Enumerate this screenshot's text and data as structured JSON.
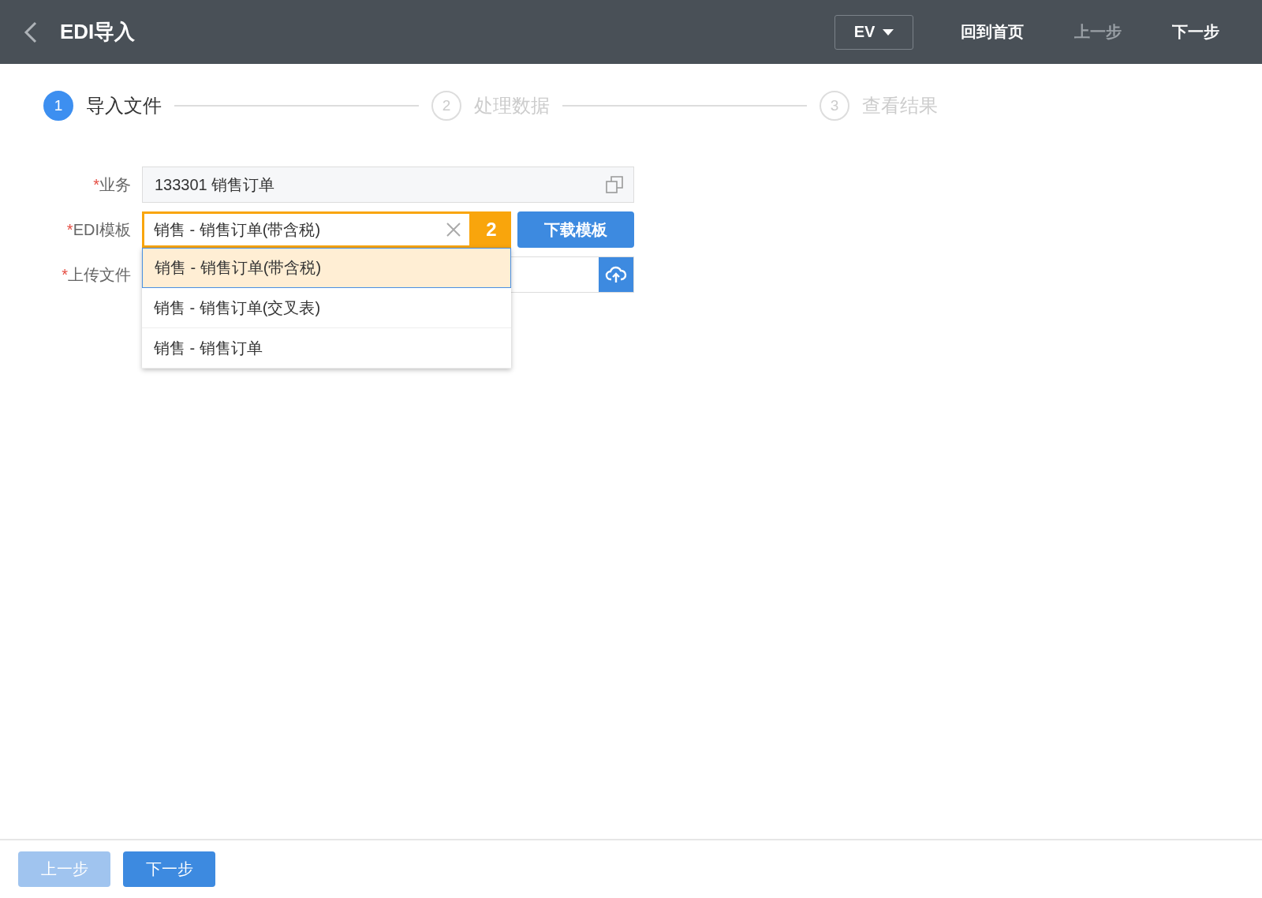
{
  "header": {
    "title": "EDI导入",
    "language": "EV",
    "actions": [
      {
        "label": "回到首页",
        "disabled": false
      },
      {
        "label": "上一步",
        "disabled": true
      },
      {
        "label": "下一步",
        "disabled": false
      }
    ]
  },
  "steps": [
    {
      "number": "1",
      "label": "导入文件",
      "selected": true
    },
    {
      "number": "2",
      "label": "处理数据",
      "selected": false
    },
    {
      "number": "3",
      "label": "查看结果",
      "selected": false
    }
  ],
  "form": {
    "rows": [
      {
        "kind": "readonly",
        "mark": "*",
        "label": "业务",
        "value": "133301 销售订单"
      },
      {
        "kind": "select",
        "mark": "*",
        "label": "EDI模板",
        "value": "销售 - 销售订单(带含税)",
        "callout": "2",
        "button": "下载模板",
        "expanded": true,
        "options": [
          {
            "label": "销售 - 销售订单(带含税)",
            "selected": true
          },
          {
            "label": "销售 - 销售订单(交叉表)",
            "selected": false
          },
          {
            "label": "销售 - 销售订单",
            "selected": false
          }
        ]
      },
      {
        "kind": "upload",
        "mark": "*",
        "label": "上传文件"
      }
    ]
  },
  "footer": {
    "buttons": [
      {
        "label": "上一步",
        "disabled": true
      },
      {
        "label": "下一步",
        "disabled": false
      }
    ]
  }
}
